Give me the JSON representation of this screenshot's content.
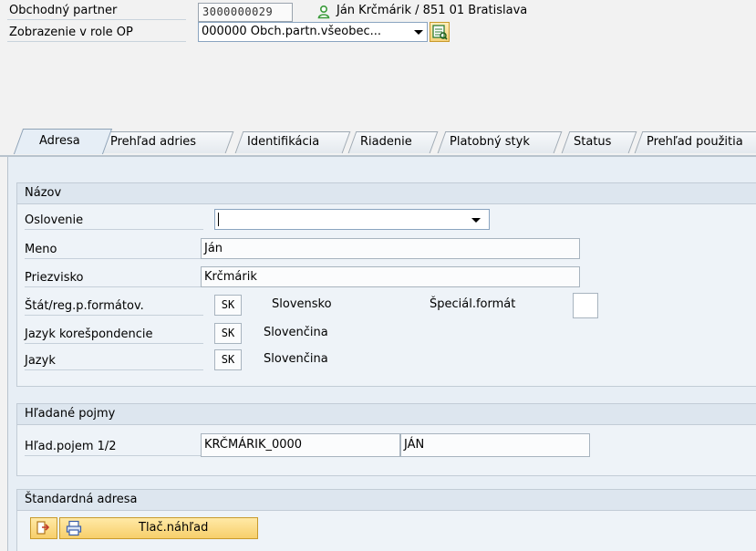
{
  "header": {
    "partner_label": "Obchodný partner",
    "partner_number": "3000000029",
    "partner_name": "Ján Krčmárik / 851 01 Bratislava",
    "role_label": "Zobrazenie v role OP",
    "role_value": "000000 Obch.partn.všeobec..."
  },
  "tabs": [
    {
      "label": "Adresa"
    },
    {
      "label": "Prehľad adries"
    },
    {
      "label": "Identifikácia"
    },
    {
      "label": "Riadenie"
    },
    {
      "label": "Platobný styk"
    },
    {
      "label": "Status"
    },
    {
      "label": "Prehľad použitia"
    }
  ],
  "nazov": {
    "title": "Názov",
    "oslovenie_label": "Oslovenie",
    "oslovenie_value": "",
    "meno_label": "Meno",
    "meno_value": "Ján",
    "priezvisko_label": "Priezvisko",
    "priezvisko_value": "Krčmárik",
    "stat_label": "Štát/reg.p.formátov.",
    "stat_code": "SK",
    "stat_name": "Slovensko",
    "special_label": "Špeciál.formát",
    "jazyk_kor_label": "Jazyk korešpondencie",
    "jazyk_kor_code": "SK",
    "jazyk_kor_name": "Slovenčina",
    "jazyk_label": "Jazyk",
    "jazyk_code": "SK",
    "jazyk_name": "Slovenčina"
  },
  "hladane": {
    "title": "Hľadané pojmy",
    "pojem_label": "Hľad.pojem 1/2",
    "pojem1": "KRČMÁRIK_0000",
    "pojem2": "JÁN"
  },
  "adresa": {
    "title": "Štandardná adresa",
    "preview_label": "Tlač.náhľad"
  },
  "colors": {
    "panel": "#e7eef5",
    "button": "#f7cf6b",
    "icon_green": "#3a9a3a"
  },
  "icons": [
    "person-icon",
    "dropdown-arrow-icon",
    "details-icon",
    "export-icon",
    "print-icon"
  ]
}
